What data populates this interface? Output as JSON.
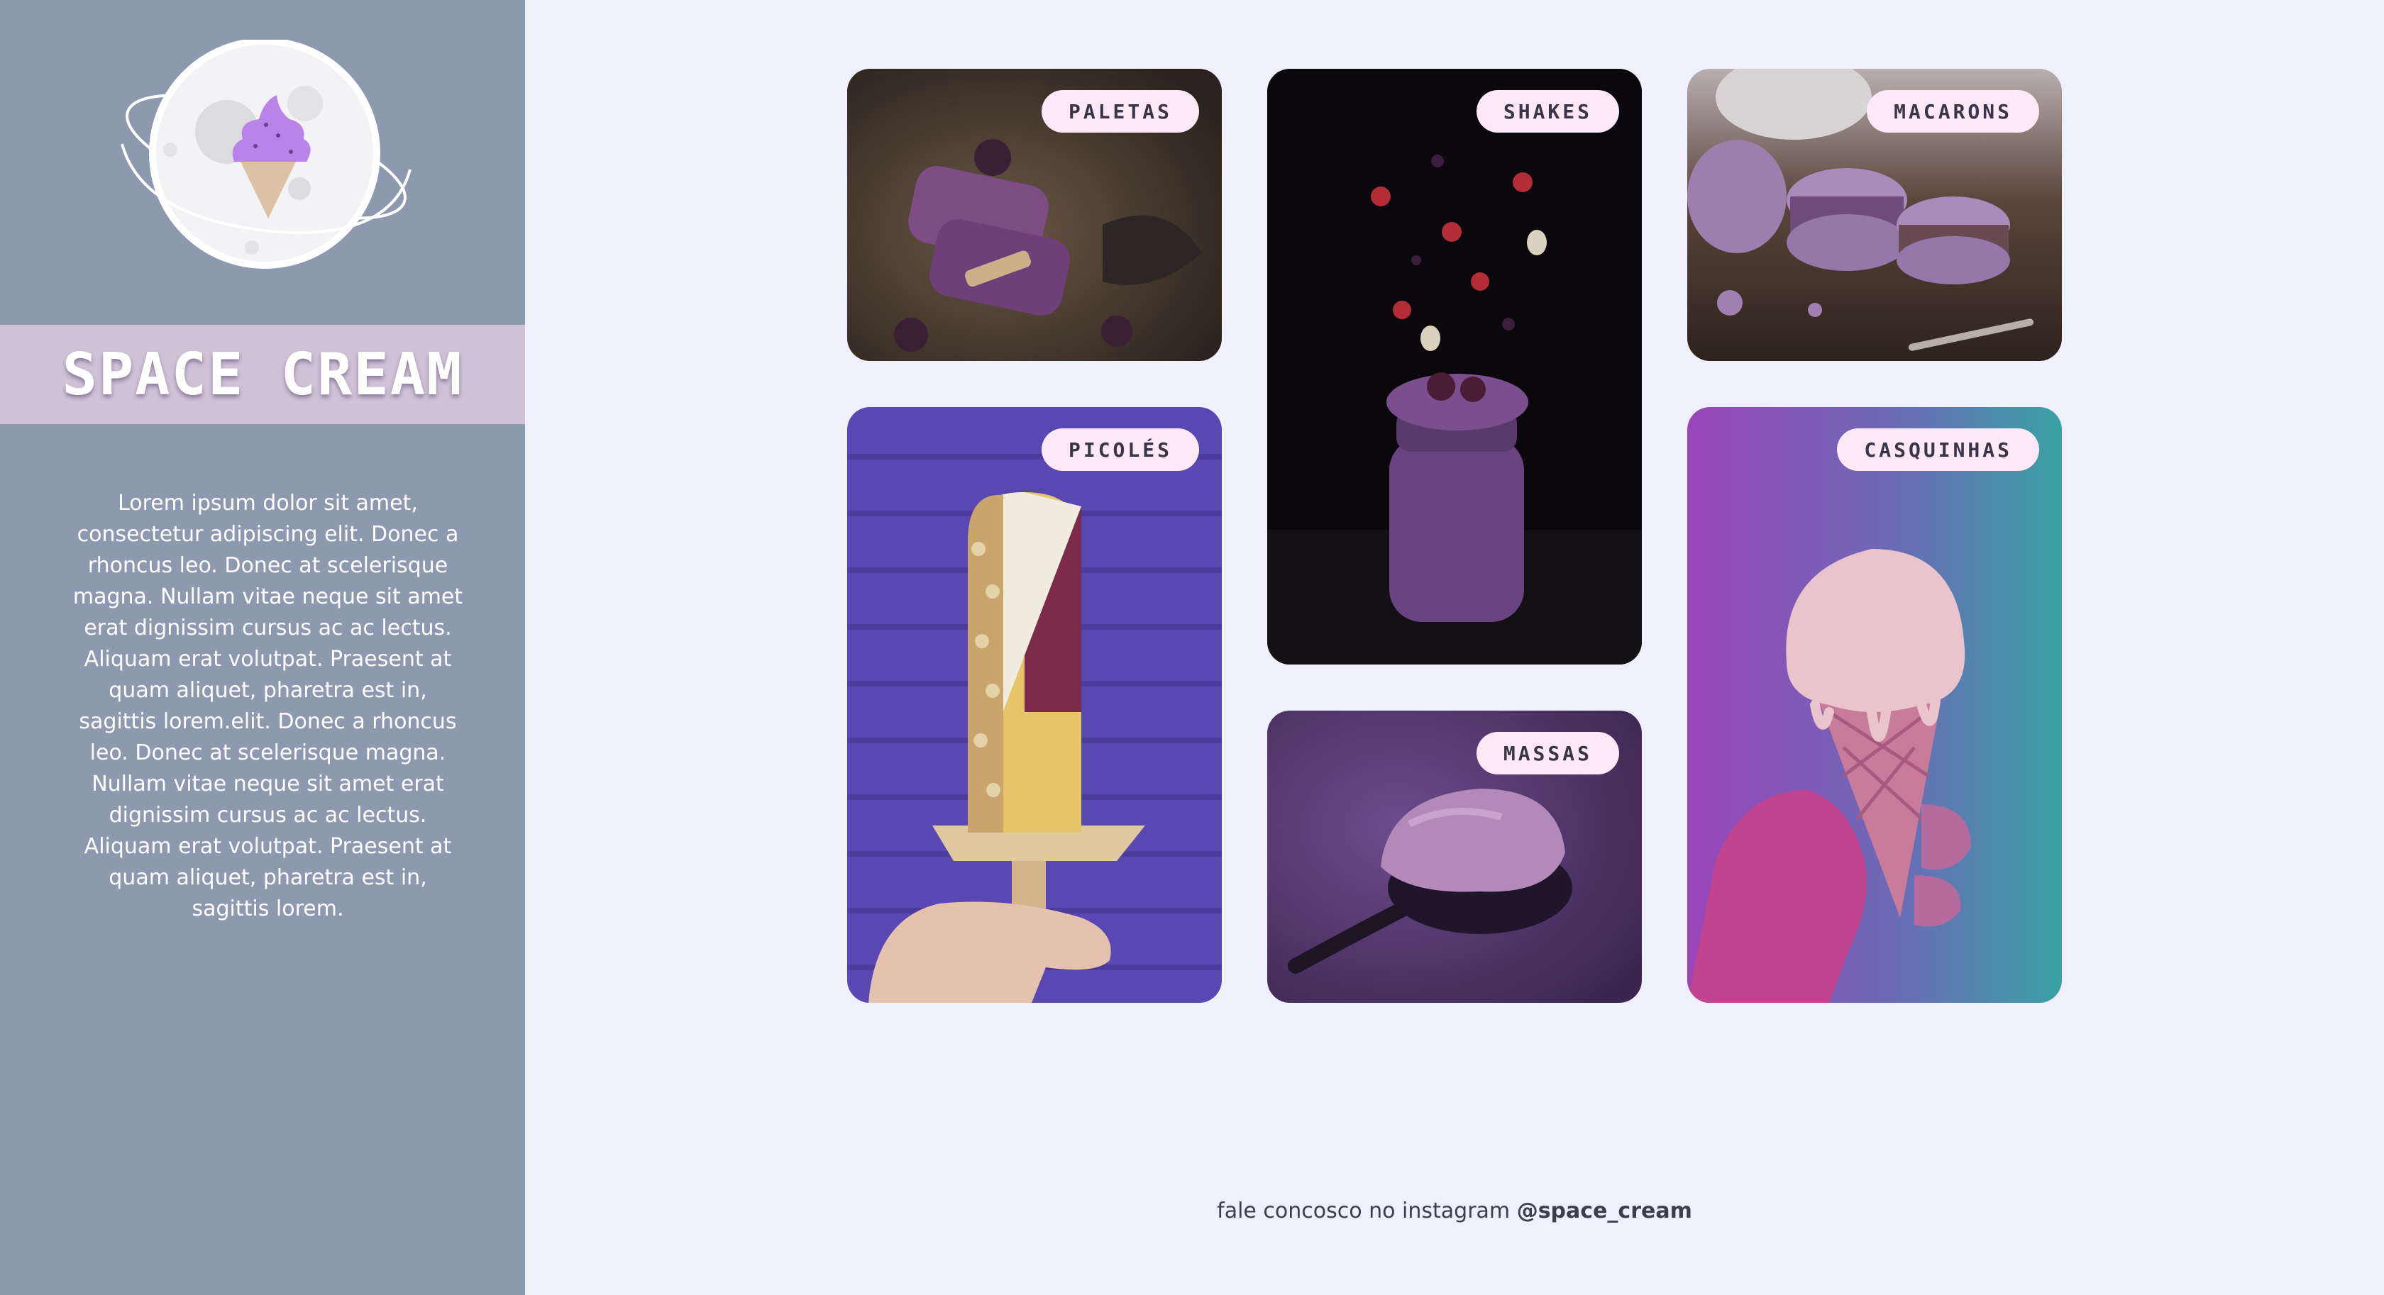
{
  "brand": {
    "title": "SPACE CREAM",
    "logo_icon": "ice-cream-planet-icon",
    "description": "Lorem ipsum dolor sit amet, consectetur adipiscing elit. Donec a rhoncus leo. Donec at scelerisque magna. Nullam vitae neque sit amet erat dignissim cursus ac ac lectus. Aliquam erat volutpat. Praesent at quam aliquet, pharetra est in, sagittis lorem.elit. Donec a rhoncus leo. Donec at scelerisque magna. Nullam vitae neque sit amet erat dignissim cursus ac ac lectus. Aliquam erat volutpat. Praesent at quam aliquet, pharetra est in, sagittis lorem."
  },
  "gallery": {
    "cards": [
      {
        "id": "paletas",
        "label": "PALETAS"
      },
      {
        "id": "shakes",
        "label": "SHAKES"
      },
      {
        "id": "macarons",
        "label": "MACARONS"
      },
      {
        "id": "picoles",
        "label": "PICOLÉS"
      },
      {
        "id": "massas",
        "label": "MASSAS"
      },
      {
        "id": "casquinhas",
        "label": "CASQUINHAS"
      }
    ]
  },
  "footer": {
    "text": "fale concosco no instagram",
    "handle": "@space_cream"
  },
  "colors": {
    "sidebar_bg": "#8d99ae",
    "brand_band": "#cfc2d6",
    "page_bg": "#eff0fc",
    "tag_bg": "#fce8f6",
    "tag_text": "#3b3448"
  }
}
